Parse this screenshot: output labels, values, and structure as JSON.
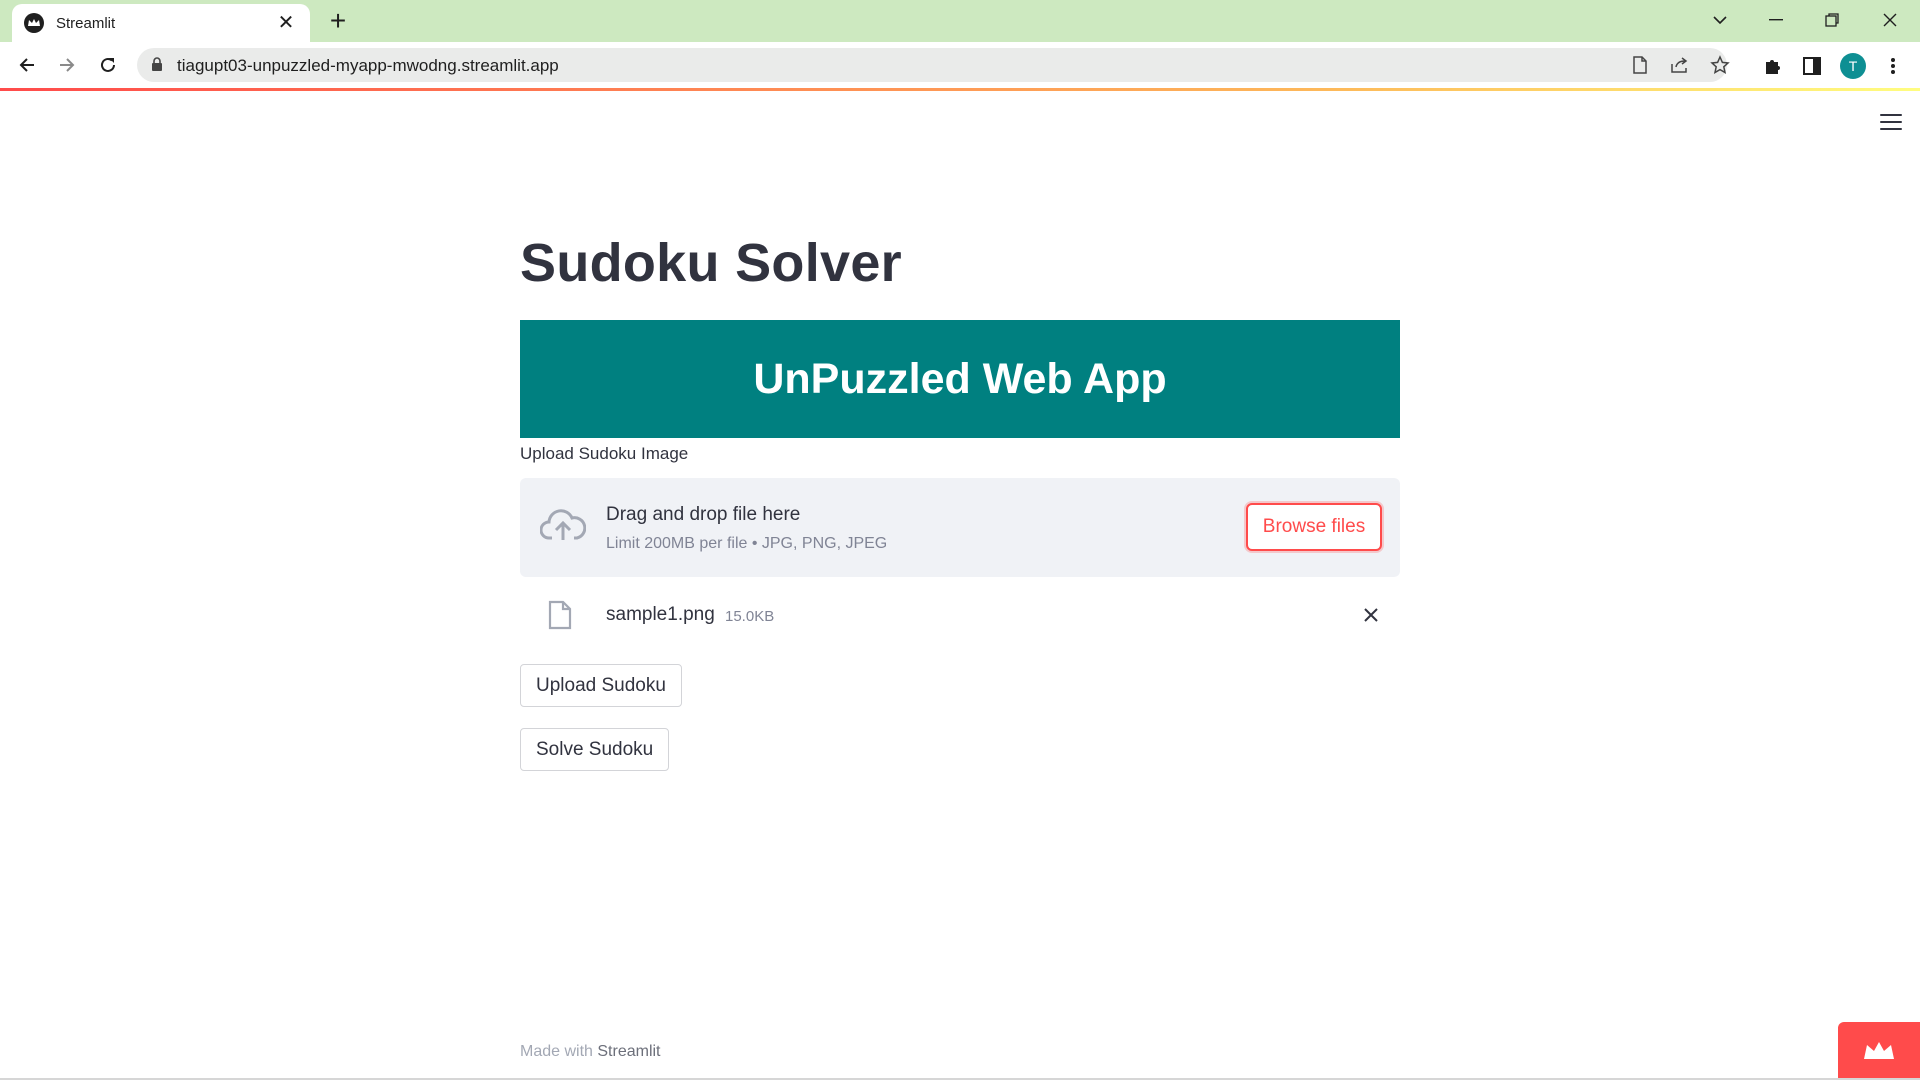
{
  "browser": {
    "tab_title": "Streamlit",
    "url": "tiagupt03-unpuzzled-myapp-mwodng.streamlit.app",
    "profile_initial": "T",
    "tabstrip_color": "#cde9c0"
  },
  "app": {
    "title": "Sudoku Solver",
    "banner": "UnPuzzled Web App",
    "banner_color": "#008080",
    "accent_color": "#ff4b4b",
    "uploader": {
      "label": "Upload Sudoku Image",
      "drop_text": "Drag and drop file here",
      "limit_text": "Limit 200MB per file • JPG, PNG, JPEG",
      "browse_label": "Browse files"
    },
    "uploaded_file": {
      "name": "sample1.png",
      "size": "15.0KB"
    },
    "buttons": {
      "upload": "Upload Sudoku",
      "solve": "Solve Sudoku"
    },
    "footer": {
      "prefix": "Made with",
      "link": "Streamlit"
    }
  },
  "icons": [
    "streamlit-favicon-icon",
    "close-icon",
    "plus-icon",
    "chevron-down-icon",
    "minimize-icon",
    "restore-icon",
    "back-arrow-icon",
    "forward-arrow-icon",
    "reload-icon",
    "lock-icon",
    "page-icon",
    "share-icon",
    "star-icon",
    "puzzle-icon",
    "sidebar-icon",
    "kebab-menu-icon",
    "hamburger-icon",
    "cloud-upload-icon",
    "file-icon",
    "streamlit-crown-icon"
  ]
}
